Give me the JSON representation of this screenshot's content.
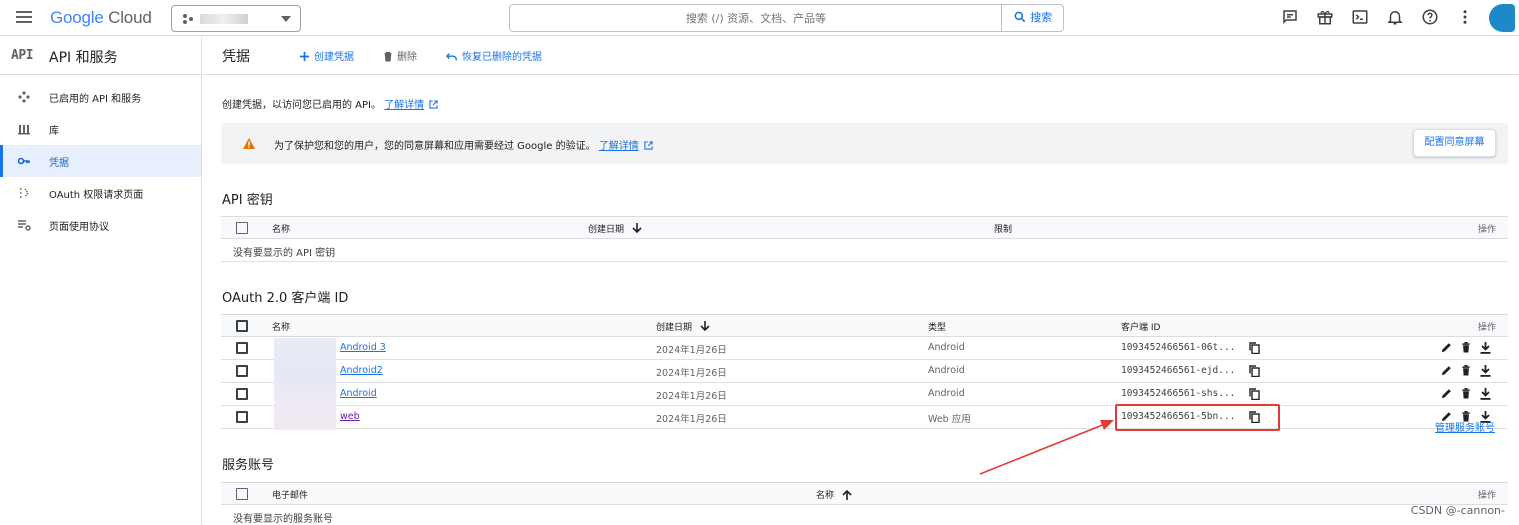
{
  "topbar": {
    "logo_google": "Google",
    "logo_cloud": "Cloud",
    "search_placeholder": "搜索 (/) 资源、文档、产品等",
    "search_button": "搜索",
    "icons": [
      "menu-icon",
      "project-icon",
      "search-icon",
      "notes-icon",
      "gift-icon",
      "terminal-icon",
      "bell-icon",
      "help-icon",
      "more-vert-icon",
      "avatar"
    ]
  },
  "sidebar": {
    "logo": "API",
    "title": "API 和服务",
    "items": [
      {
        "label": "已启用的 API 和服务",
        "icon": "api-hub-icon"
      },
      {
        "label": "库",
        "icon": "library-icon"
      },
      {
        "label": "凭据",
        "icon": "key-icon",
        "active": true
      },
      {
        "label": "OAuth 权限请求页面",
        "icon": "consent-icon"
      },
      {
        "label": "页面使用协议",
        "icon": "settings-list-icon"
      }
    ]
  },
  "toolbar": {
    "title": "凭据",
    "create": "创建凭据",
    "delete": "删除",
    "restore": "恢复已删除的凭据"
  },
  "intro": {
    "text": "创建凭据，以访问您已启用的 API。",
    "link": "了解详情"
  },
  "banner": {
    "text": "为了保护您和您的用户，您的同意屏幕和应用需要经过 Google 的验证。",
    "link": "了解详情",
    "button": "配置同意屏幕"
  },
  "api_keys": {
    "title": "API 密钥",
    "columns": [
      "名称",
      "创建日期",
      "限制",
      "操作"
    ],
    "empty": "没有要显示的 API 密钥"
  },
  "oauth": {
    "title": "OAuth 2.0 客户端 ID",
    "columns": [
      "名称",
      "创建日期",
      "类型",
      "客户端 ID",
      "操作"
    ],
    "rows": [
      {
        "name": "Android 3",
        "date": "2024年1月26日",
        "type": "Android",
        "client_id": "1093452466561-06t..."
      },
      {
        "name": "Android2",
        "date": "2024年1月26日",
        "type": "Android",
        "client_id": "1093452466561-ejd..."
      },
      {
        "name": "Android",
        "date": "2024年1月26日",
        "type": "Android",
        "client_id": "1093452466561-shs..."
      },
      {
        "name": "web",
        "date": "2024年1月26日",
        "type": "Web 应用",
        "client_id": "1093452466561-5bn..."
      }
    ]
  },
  "service_accounts": {
    "title": "服务账号",
    "manage_link": "管理服务账号",
    "columns": [
      "电子邮件",
      "名称",
      "操作"
    ],
    "empty": "没有要显示的服务账号"
  },
  "watermark": "CSDN @-cannon-",
  "colors": {
    "accent": "#1a73e8",
    "warning": "#e37400",
    "highlight": "#e53935"
  }
}
